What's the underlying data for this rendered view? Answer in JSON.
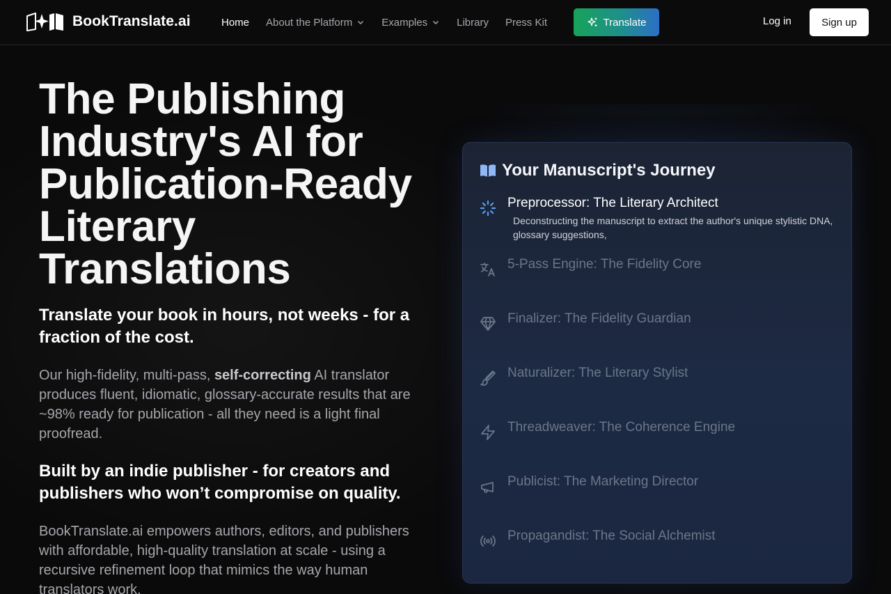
{
  "brand": {
    "name": "BookTranslate.ai"
  },
  "nav": {
    "links": [
      {
        "label": "Home",
        "active": true,
        "dropdown": false
      },
      {
        "label": "About the Platform",
        "active": false,
        "dropdown": true
      },
      {
        "label": "Examples",
        "active": false,
        "dropdown": true
      },
      {
        "label": "Library",
        "active": false,
        "dropdown": false
      },
      {
        "label": "Press Kit",
        "active": false,
        "dropdown": false
      }
    ],
    "translate_label": "Translate",
    "login_label": "Log in",
    "signup_label": "Sign up"
  },
  "hero": {
    "title": "The Publishing Industry's AI for Publication-Ready Literary Translations",
    "subheading1": "Translate your book in hours, not weeks - for a fraction of the cost.",
    "para1_before": "Our high-fidelity, multi-pass, ",
    "para1_bold": "self-correcting",
    "para1_after": " AI translator produces fluent, idiomatic, glossary-accurate results that are ~98% ready for publication - all they need is a light final proofread.",
    "subheading2": "Built by an indie publisher - for creators and publishers who won’t compromise on quality.",
    "para2": "BookTranslate.ai empowers authors, editors, and publishers with affordable, high-quality translation at scale - using a recursive refinement loop that mimics the way human translators work."
  },
  "journey": {
    "title": "Your Manuscript's Journey",
    "title_icon": "book-open-icon",
    "steps": [
      {
        "label": "Preprocessor: The Literary Architect",
        "icon": "loader-icon",
        "active": true,
        "description": "Deconstructing the manuscript to extract the author's unique stylistic DNA, glossary suggestions,"
      },
      {
        "label": "5-Pass Engine: The Fidelity Core",
        "icon": "languages-icon",
        "active": false
      },
      {
        "label": "Finalizer: The Fidelity Guardian",
        "icon": "gem-icon",
        "active": false
      },
      {
        "label": "Naturalizer: The Literary Stylist",
        "icon": "brush-icon",
        "active": false
      },
      {
        "label": "Threadweaver: The Coherence Engine",
        "icon": "zap-icon",
        "active": false
      },
      {
        "label": "Publicist: The Marketing Director",
        "icon": "megaphone-icon",
        "active": false
      },
      {
        "label": "Propagandist: The Social Alchemist",
        "icon": "radio-icon",
        "active": false
      }
    ]
  },
  "colors": {
    "background": "#0a0a0b",
    "card": "#1d2a44",
    "translate_gradient_start": "#17a35a",
    "translate_gradient_end": "#2c6fc6",
    "active_icon": "#5b9cf0",
    "inactive_text": "#6c7689"
  }
}
